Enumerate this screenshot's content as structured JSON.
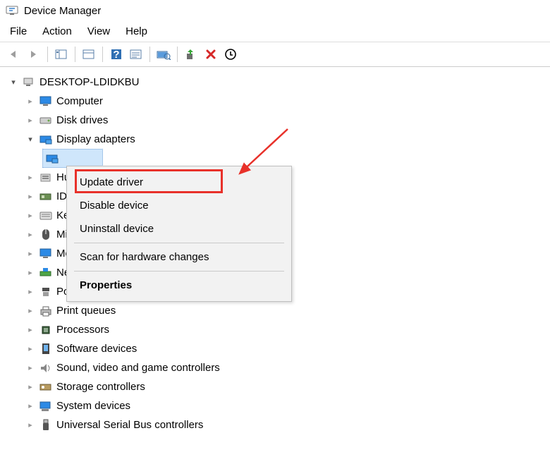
{
  "title": "Device Manager",
  "menu": {
    "file": "File",
    "action": "Action",
    "view": "View",
    "help": "Help"
  },
  "root": {
    "name": "DESKTOP-LDIDKBU"
  },
  "nodes": {
    "computer": "Computer",
    "disk": "Disk drives",
    "display": "Display adapters",
    "hid": "Human Interface Devices",
    "ide": "IDE ATA/ATAPI controllers",
    "keyboards": "Keyboards",
    "mice": "Mice and other pointing devices",
    "monitors": "Monitors",
    "network": "Network adapters",
    "ports": "Ports (COM & LPT)",
    "printq": "Print queues",
    "processors": "Processors",
    "software": "Software devices",
    "sound": "Sound, video and game controllers",
    "storage": "Storage controllers",
    "system": "System devices",
    "usb": "Universal Serial Bus controllers"
  },
  "context_menu": {
    "update": "Update driver",
    "disable": "Disable device",
    "uninstall": "Uninstall device",
    "scan": "Scan for hardware changes",
    "properties": "Properties"
  }
}
